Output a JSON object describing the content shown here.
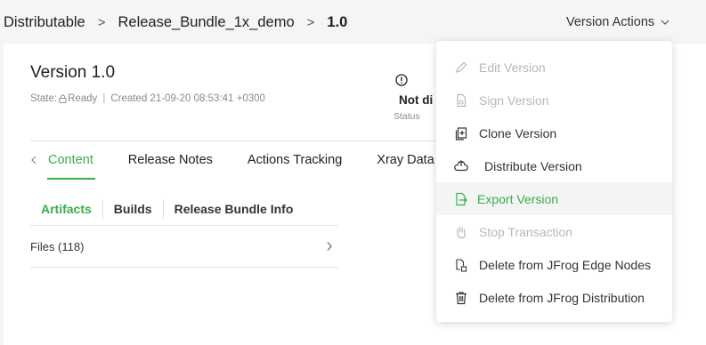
{
  "breadcrumb": {
    "items": [
      "Distributable",
      "Release_Bundle_1x_demo"
    ],
    "current": "1.0",
    "separator": ">"
  },
  "header": {
    "version_actions_label": "Version Actions"
  },
  "version": {
    "title": "Version 1.0",
    "state_label": "State:",
    "state_value": "Ready",
    "created": "Created 21-09-20 08:53:41 +0300",
    "status_value": "Not di",
    "status_label": "Status"
  },
  "tabs": [
    {
      "label": "Content",
      "active": true
    },
    {
      "label": "Release Notes",
      "active": false
    },
    {
      "label": "Actions Tracking",
      "active": false
    },
    {
      "label": "Xray Data",
      "active": false
    }
  ],
  "subtabs": [
    {
      "label": "Artifacts",
      "active": true
    },
    {
      "label": "Builds",
      "active": false
    },
    {
      "label": "Release Bundle Info",
      "active": false
    }
  ],
  "files_row": {
    "label": "Files (118)"
  },
  "menu": {
    "items": [
      {
        "label": "Edit Version",
        "icon": "pencil-icon",
        "state": "disabled"
      },
      {
        "label": "Sign Version",
        "icon": "sign-document-icon",
        "state": "disabled"
      },
      {
        "label": "Clone Version",
        "icon": "clone-icon",
        "state": "enabled"
      },
      {
        "label": "Distribute Version",
        "icon": "cloud-distribute-icon",
        "state": "enabled"
      },
      {
        "label": "Export Version",
        "icon": "export-icon",
        "state": "highlighted"
      },
      {
        "label": "Stop Transaction",
        "icon": "hand-stop-icon",
        "state": "disabled"
      },
      {
        "label": "Delete from JFrog Edge Nodes",
        "icon": "delete-edge-icon",
        "state": "enabled"
      },
      {
        "label": "Delete from JFrog Distribution",
        "icon": "trash-icon",
        "state": "enabled"
      }
    ]
  },
  "colors": {
    "accent": "#3aae4a",
    "disabled": "#b8b8b8",
    "background": "#f4f5f7"
  }
}
